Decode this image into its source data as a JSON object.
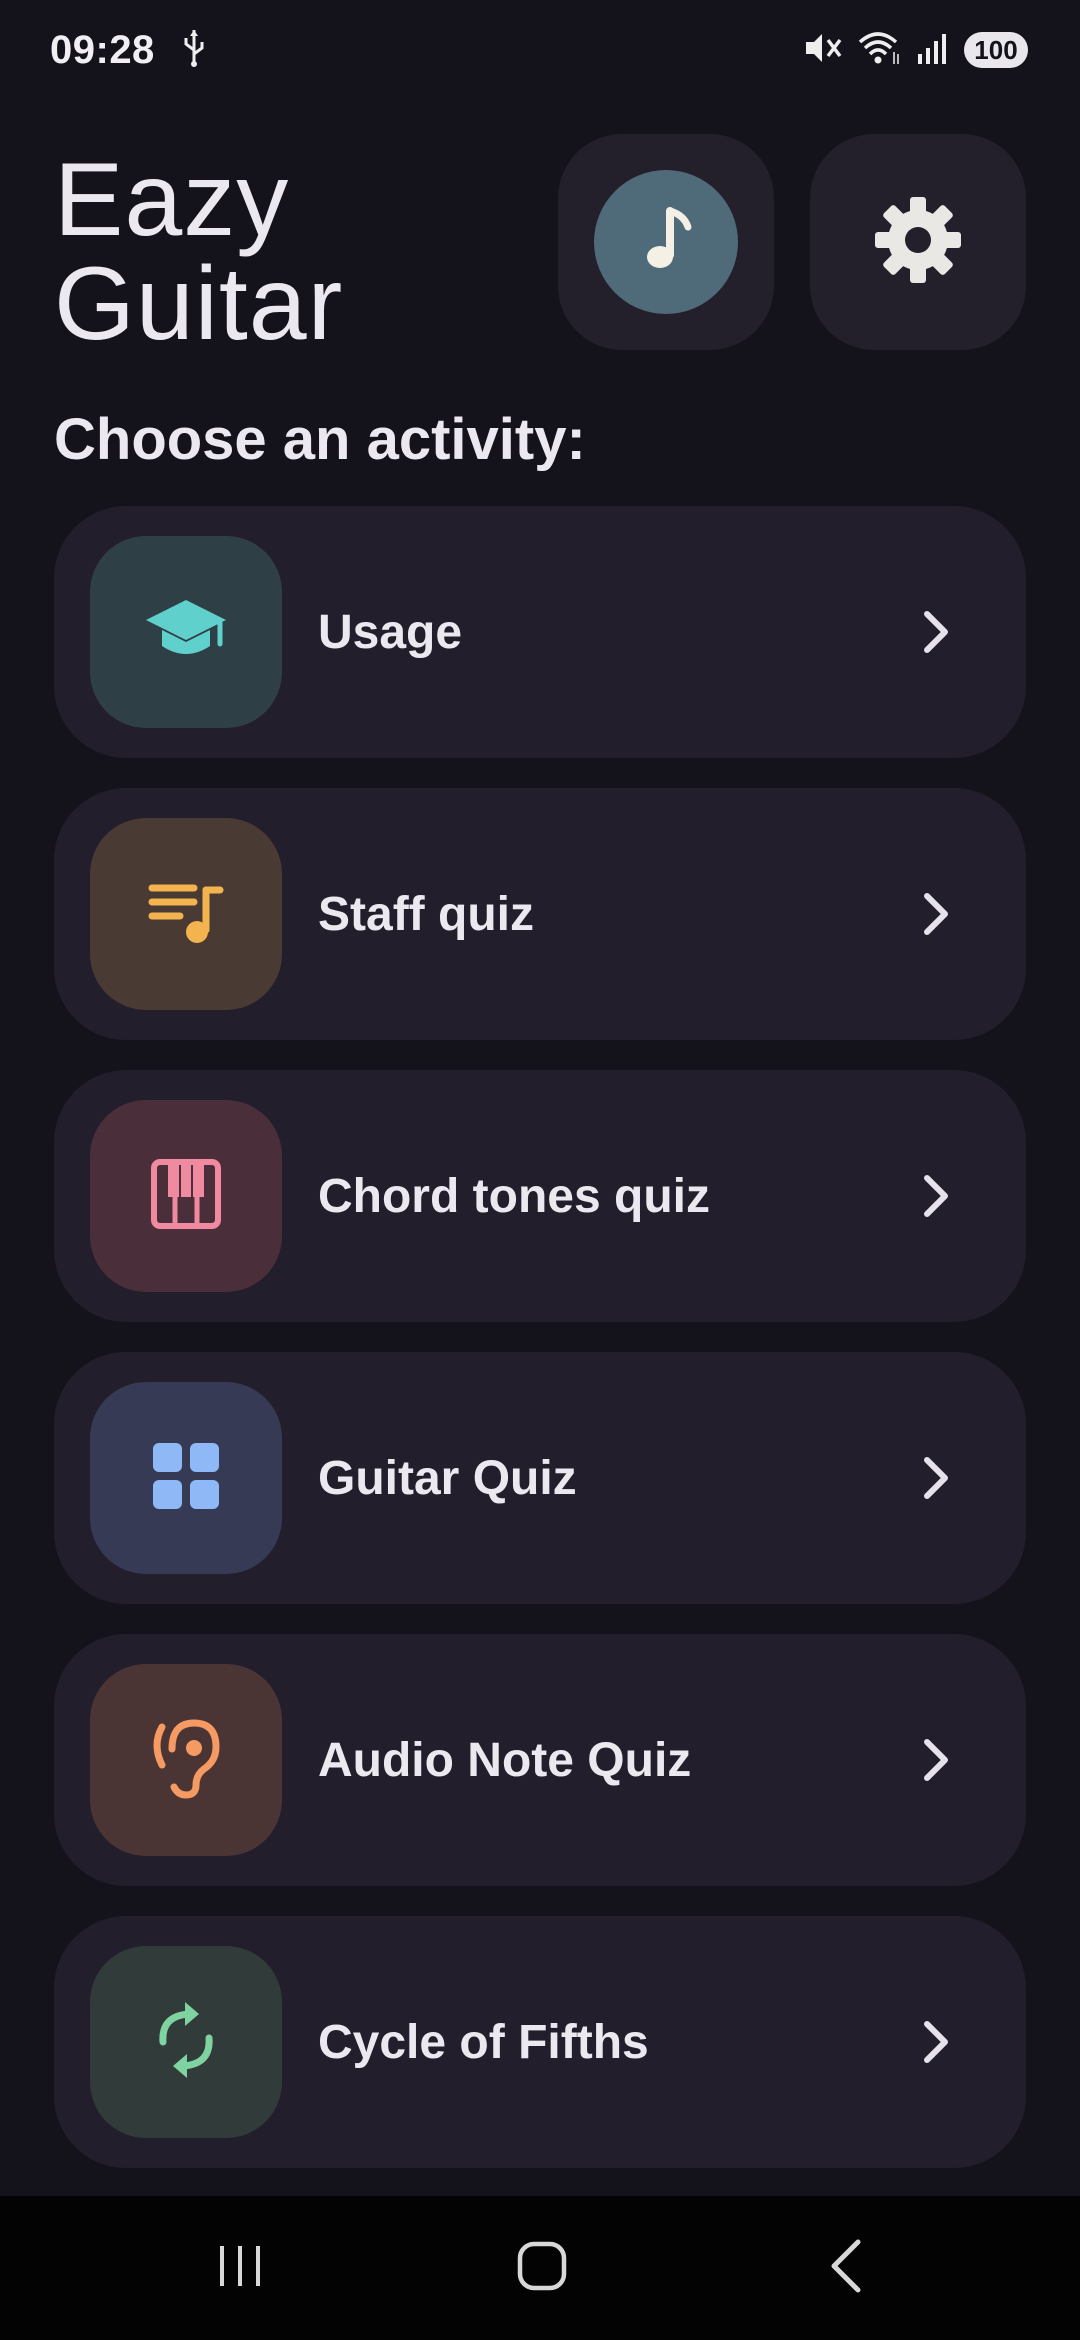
{
  "status_bar": {
    "time": "09:28",
    "battery": "100",
    "icons": [
      "usb-icon",
      "mute-icon",
      "wifi-icon",
      "signal-icon"
    ]
  },
  "header": {
    "title_line1": "Eazy",
    "title_line2": "Guitar",
    "music_button_icon": "music-note-icon",
    "settings_button_icon": "gear-icon"
  },
  "section_heading": "Choose an activity:",
  "activities": [
    {
      "label": "Usage",
      "icon": "graduation-cap-icon",
      "tile_color": "#2e4046",
      "icon_color": "#5fd0cc"
    },
    {
      "label": "Staff quiz",
      "icon": "music-list-icon",
      "tile_color": "#4a3a34",
      "icon_color": "#f3b44f"
    },
    {
      "label": "Chord tones quiz",
      "icon": "piano-icon",
      "tile_color": "#4a2e3a",
      "icon_color": "#f08aa0"
    },
    {
      "label": "Guitar Quiz",
      "icon": "grid-icon",
      "tile_color": "#363a54",
      "icon_color": "#8fb8f7"
    },
    {
      "label": "Audio Note Quiz",
      "icon": "ear-icon",
      "tile_color": "#4b3534",
      "icon_color": "#f59a62"
    },
    {
      "label": "Cycle of Fifths",
      "icon": "sync-icon",
      "tile_color": "#313c3a",
      "icon_color": "#7ed3a0"
    }
  ],
  "colors": {
    "background": "#14121a",
    "card": "#231e2b",
    "text": "#ece8f0"
  },
  "nav_bar": {
    "icons": [
      "recent-apps-icon",
      "home-icon",
      "back-icon"
    ]
  }
}
